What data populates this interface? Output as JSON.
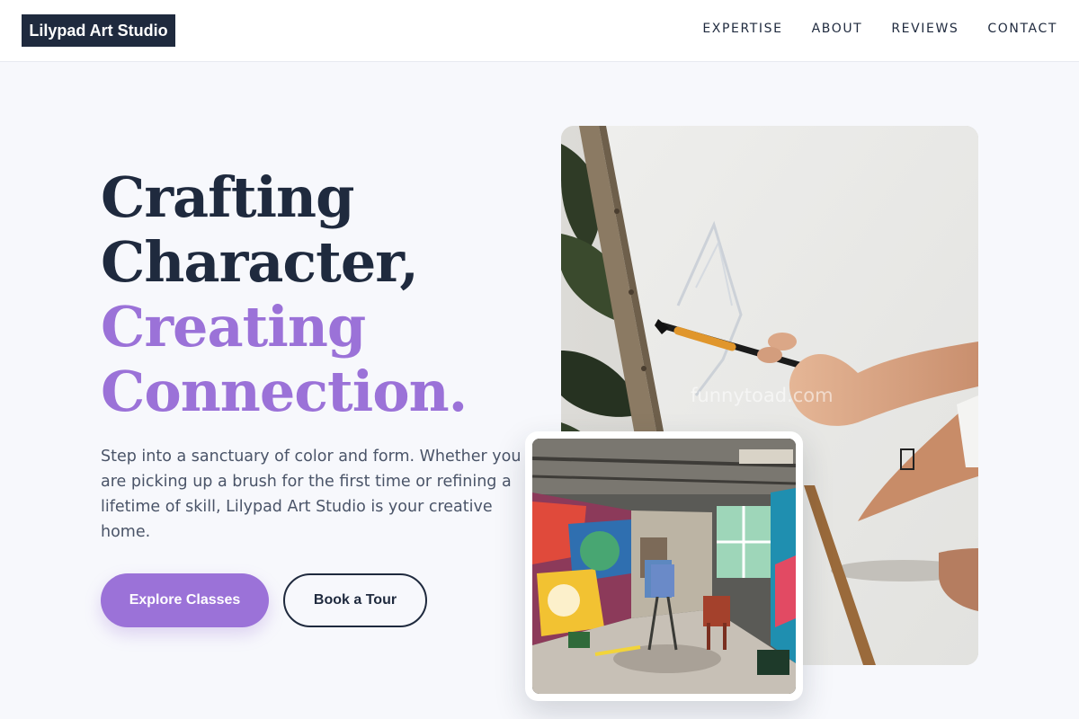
{
  "brand": {
    "name": "Lilypad Art Studio"
  },
  "nav": {
    "links": [
      "EXPERTISE",
      "ABOUT",
      "REVIEWS",
      "CONTACT"
    ]
  },
  "hero": {
    "headline_line1": "Crafting",
    "headline_line2": "Character,",
    "headline_line3": "Creating",
    "headline_line4": "Connection.",
    "lede": "Step into a sanctuary of color and form. Whether you are picking up a brush for the first time or refining a lifetime of skill, Lilypad Art Studio is your creative home.",
    "primary_cta": "Explore Classes",
    "secondary_cta": "Book a Tour"
  },
  "images": {
    "main_watermark": "funnytoad.com"
  },
  "colors": {
    "navy": "#1f2a3e",
    "accent_purple": "#9b72d8",
    "page_bg": "#f7f8fc",
    "body_text": "#4a5468"
  }
}
